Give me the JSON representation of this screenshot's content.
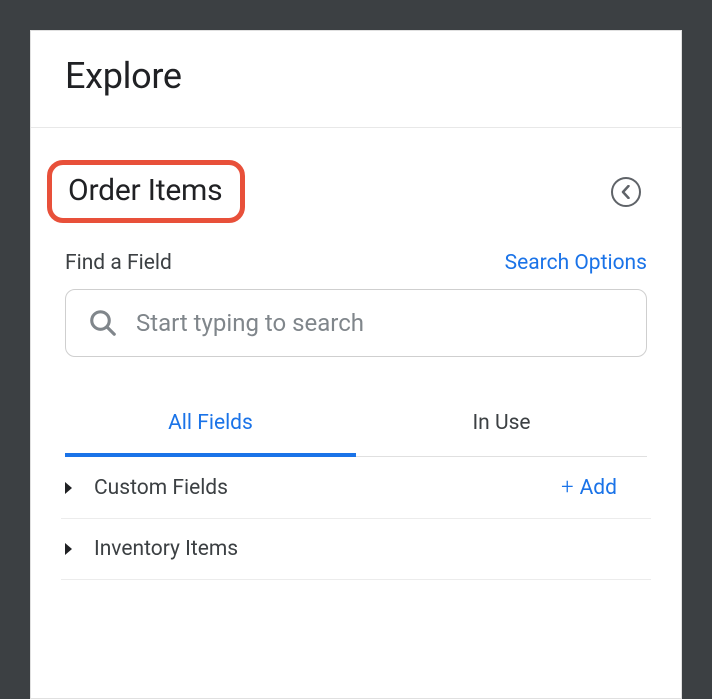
{
  "header": {
    "title": "Explore"
  },
  "section": {
    "title": "Order Items",
    "search_label": "Find a Field",
    "search_options": "Search Options",
    "search_placeholder": "Start typing to search"
  },
  "tabs": {
    "all_fields": "All Fields",
    "in_use": "In Use"
  },
  "groups": [
    {
      "label": "Custom Fields",
      "add_label": "Add"
    },
    {
      "label": "Inventory Items"
    }
  ],
  "colors": {
    "link": "#1a73e8",
    "highlight_border": "#e8503a"
  }
}
